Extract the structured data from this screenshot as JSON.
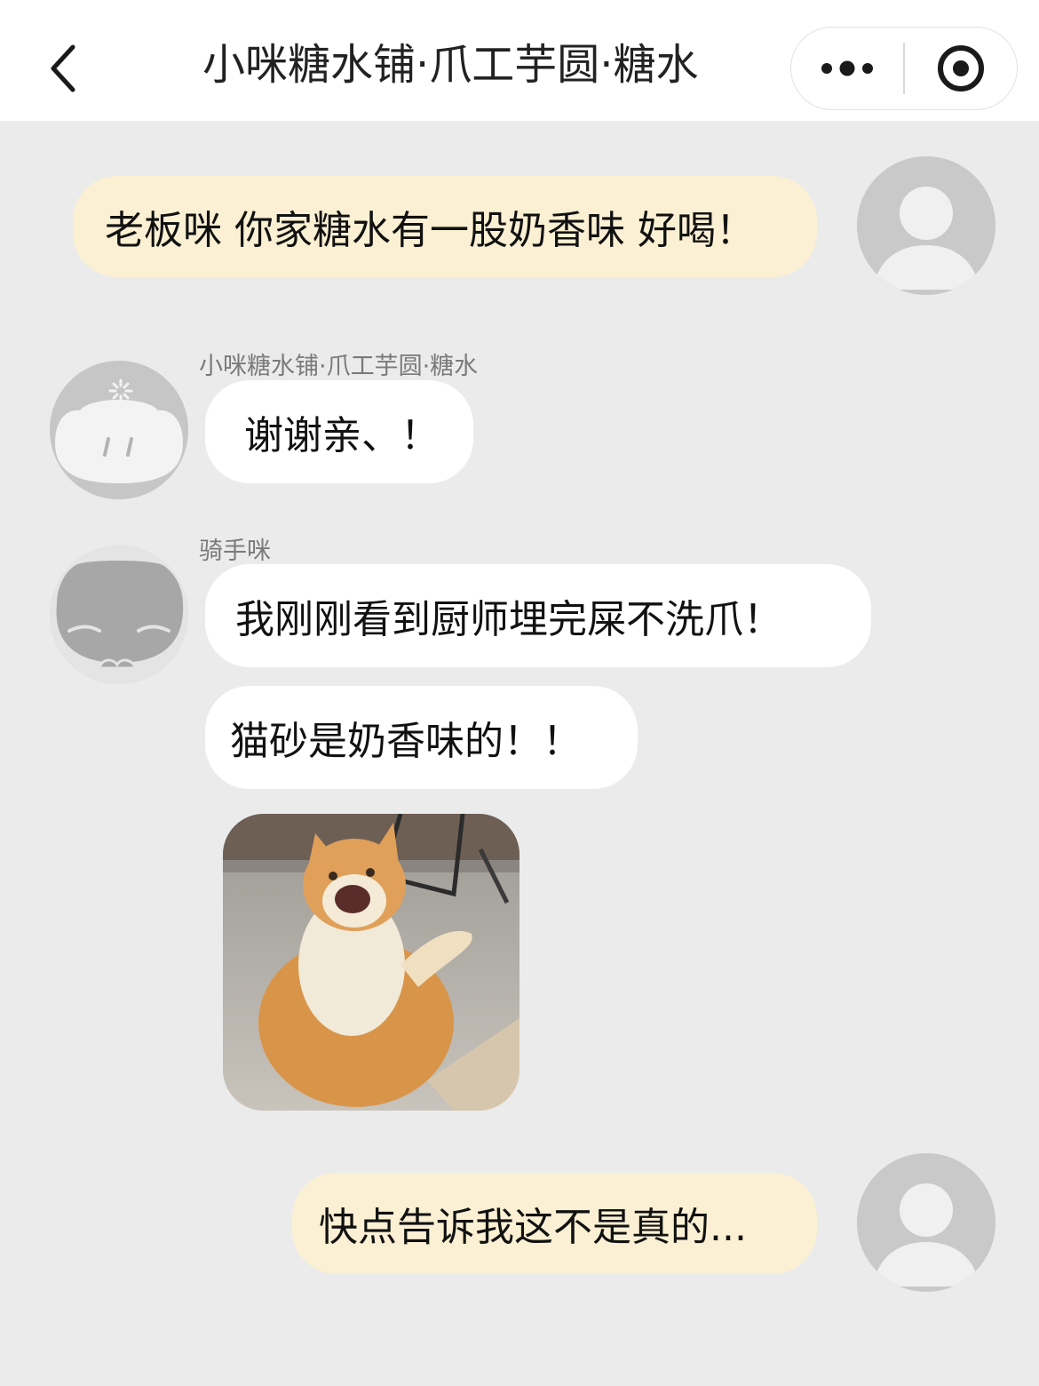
{
  "header": {
    "title": "小咪糖水铺·爪工芋圆·糖水",
    "back_icon": "chevron-left-icon",
    "more_icon": "more-dots-icon",
    "close_icon": "target-circle-icon"
  },
  "colors": {
    "background": "#ebebeb",
    "mine_bubble": "#fbf0d3",
    "theirs_bubble": "#ffffff",
    "avatar_gray": "#c9c9c9"
  },
  "messages": [
    {
      "from": "me",
      "text": "老板咪 你家糖水有一股奶香味 好喝！"
    },
    {
      "from": "shop",
      "sender": "小咪糖水铺·爪工芋圆·糖水",
      "text": "谢谢亲、！"
    },
    {
      "from": "rider",
      "sender": "骑手咪",
      "text": "我刚刚看到厨师埋完屎不洗爪！"
    },
    {
      "from": "rider",
      "text": "猫砂是奶香味的！！"
    },
    {
      "from": "rider",
      "sticker": "screaming-orange-cat-sticker"
    },
    {
      "from": "me",
      "text": "快点告诉我这不是真的..."
    }
  ]
}
